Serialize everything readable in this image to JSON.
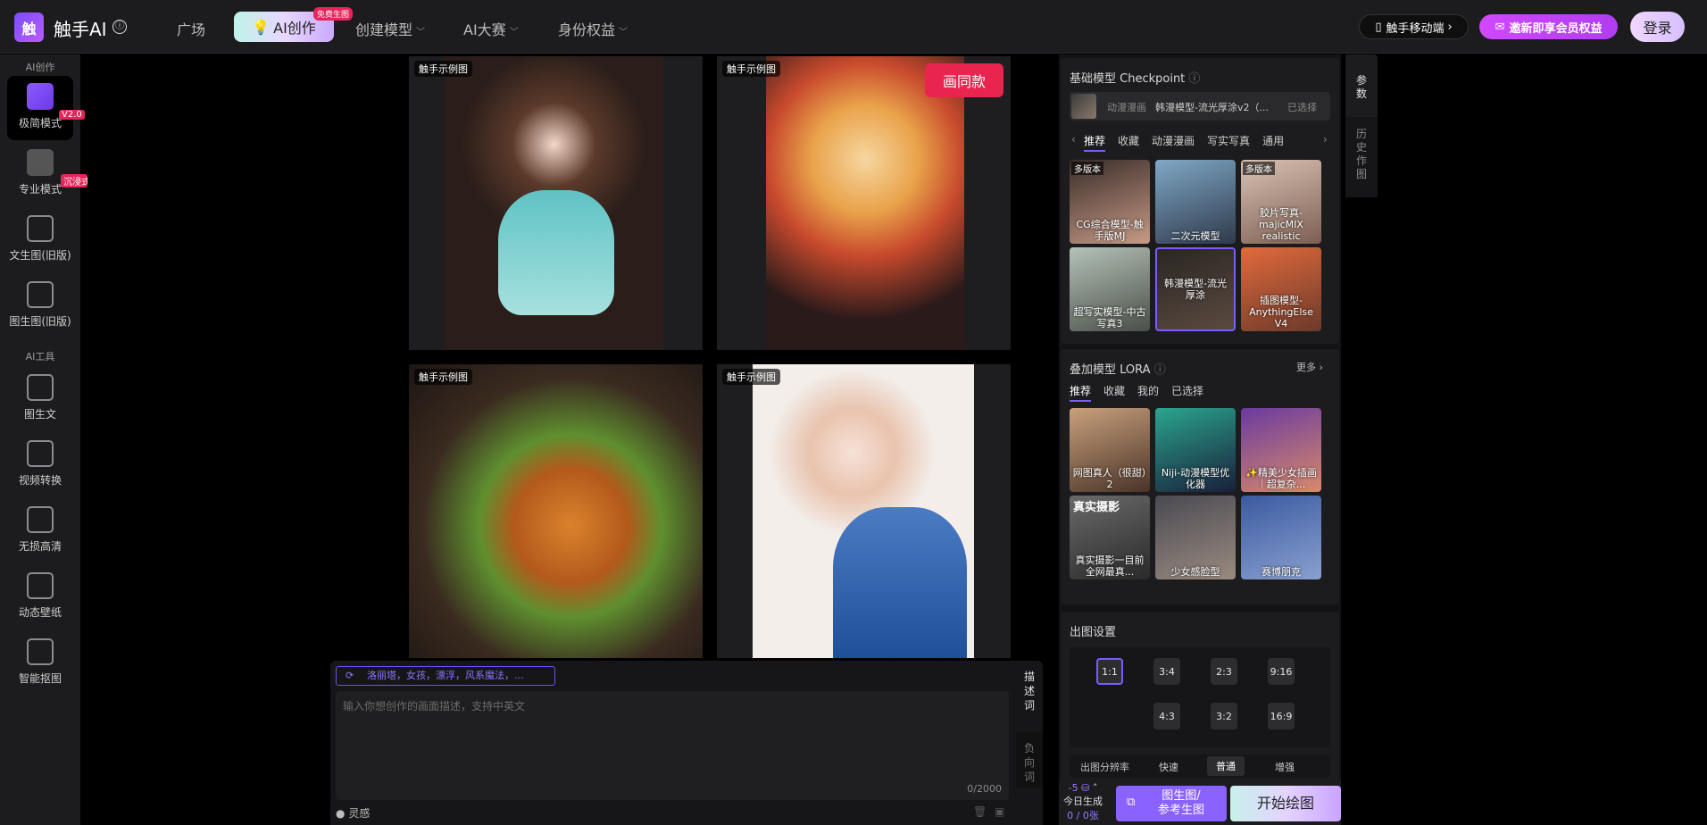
{
  "header": {
    "logo_letter": "触",
    "brand": "触手AI",
    "info_icon": "ⓘ",
    "nav": [
      {
        "label": "广场"
      },
      {
        "label": "AI创作",
        "badge": "免费生图"
      },
      {
        "label": "创建模型"
      },
      {
        "label": "AI大赛"
      },
      {
        "label": "身份权益"
      }
    ],
    "mobile_label": "触手移动端",
    "vip_label": "邀新即享会员权益",
    "login_label": "登录"
  },
  "sidebar": {
    "section1": "AI创作",
    "section2": "AI工具",
    "items": [
      {
        "label": "极简模式",
        "badge": "V2.0"
      },
      {
        "label": "专业模式",
        "badge": "沉浸式"
      },
      {
        "label": "文生图(旧版)"
      },
      {
        "label": "图生图(旧版)"
      },
      {
        "label": "图生文"
      },
      {
        "label": "视频转换"
      },
      {
        "label": "无损高清"
      },
      {
        "label": "动态壁纸"
      },
      {
        "label": "智能抠图"
      }
    ]
  },
  "gallery": {
    "card_label": "触手示例图",
    "same_style_button": "画同款"
  },
  "prompt": {
    "tags": "洛丽塔，女孩，漂浮，风系魔法，...",
    "placeholder": "输入你想创作的画面描述，支持中英文",
    "count": "0/2000",
    "inspiration": "灵感",
    "tab_describe": "描述词",
    "tab_negative": "负向词"
  },
  "right_panel": {
    "checkpoint_title": "基础模型 Checkpoint",
    "selected_model_category": "动漫漫画",
    "selected_model_name": "韩漫模型-流光厚涂v2（...",
    "selected_label": "已选择",
    "checkpoint_tabs": [
      "推荐",
      "收藏",
      "动漫漫画",
      "写实写真",
      "通用"
    ],
    "models": [
      {
        "caption": "CG综合模型-触手版MJ",
        "version": "多版本"
      },
      {
        "caption": "二次元模型",
        "version": ""
      },
      {
        "caption": "胶片写真-majicMIX realistic",
        "version": "多版本"
      },
      {
        "caption": "超写实模型-中古写真3",
        "version": ""
      },
      {
        "caption": "韩漫模型-流光厚涂",
        "version": ""
      },
      {
        "caption": "插图模型-AnythingElse V4",
        "version": ""
      }
    ],
    "lora_title": "叠加模型 LORA",
    "lora_more": "更多",
    "lora_tabs": [
      "推荐",
      "收藏",
      "我的",
      "已选择"
    ],
    "loras": [
      {
        "caption": "网图真人（很甜）2"
      },
      {
        "caption": "Niji-动漫模型优化器"
      },
      {
        "caption": "✨精美少女插画｜超复杂..."
      },
      {
        "caption": "真实摄影一目前全网最真..."
      },
      {
        "caption": "少女感脸型"
      },
      {
        "caption": "赛博朋克"
      }
    ],
    "lora_overlay": "真实摄影",
    "output_title": "出图设置",
    "ratios": [
      "1:1",
      "3:4",
      "2:3",
      "9:16",
      "4:3",
      "3:2",
      "16:9"
    ],
    "resolution_label": "出图分辨率",
    "resolution_options": [
      "快速",
      "普通",
      "增强"
    ],
    "cost": "-5",
    "today_label": "今日生成",
    "today_count": "0 / 0张",
    "img2img_line1": "图生图/",
    "img2img_line2": "参考生图",
    "start_button": "开始绘图",
    "side_tab_params": "参数",
    "side_tab_history": "历史作图"
  },
  "colors": {
    "accent": "#7a5cff",
    "brand_red": "#e8244f",
    "panel": "#1c1c1e",
    "vip": "#c445f6"
  }
}
